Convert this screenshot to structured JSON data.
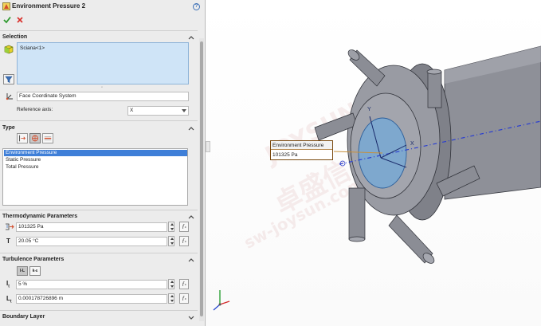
{
  "panel": {
    "title": "Environment Pressure 2",
    "help_label": "?"
  },
  "selection": {
    "title": "Selection",
    "item": "Sciana<1>",
    "coordinate_system": "Face Coordinate System",
    "reference_axis_label": "Reference axis:",
    "reference_axis_value": "X"
  },
  "type": {
    "title": "Type",
    "options": [
      "Environment Pressure",
      "Static Pressure",
      "Total Pressure"
    ],
    "selected": "Environment Pressure"
  },
  "thermo": {
    "title": "Thermodynamic Parameters",
    "pressure": "101325 Pa",
    "temperature_symbol": "T",
    "temperature": "20.05 °C"
  },
  "turbulence": {
    "title": "Turbulence Parameters",
    "mode_ti_label": "I-L",
    "mode_ke_label": "k-ε",
    "intensity_symbol": "I",
    "intensity_sub": "t",
    "intensity": "5 %",
    "length_symbol": "L",
    "length_sub": "t",
    "length": "0.000178726896 m"
  },
  "boundary": {
    "title": "Boundary Layer"
  },
  "viewport": {
    "callout_title": "Environment Pressure",
    "callout_value": "101325 Pa",
    "watermark_cn": "卓盛信息",
    "watermark_en": "JOYSUN",
    "watermark_url": "sw-joysun.com",
    "axis_x": "X",
    "axis_y": "Y"
  },
  "colors": {
    "accent": "#3f7fd8",
    "ok": "#2f9a2f",
    "cancel": "#d9302b",
    "selection_box": "#cfe4f7",
    "callout_border": "#7a4a10"
  }
}
